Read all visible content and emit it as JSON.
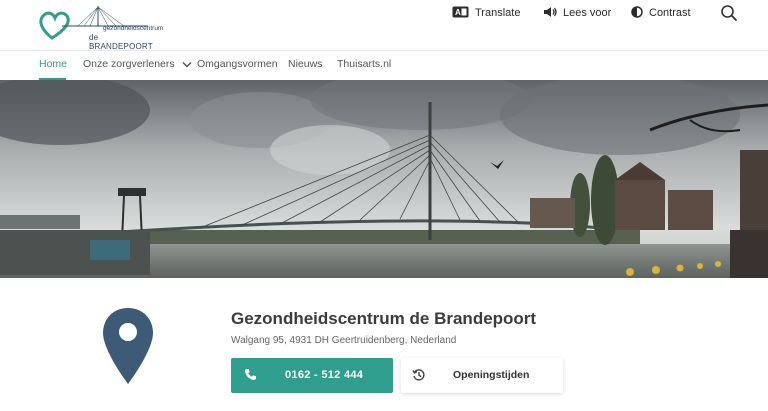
{
  "header": {
    "logo": {
      "line1": "gezondheidscentrum",
      "line2": "de BRANDEPOORT",
      "brand_teal": "#2f9e8f",
      "brand_navy": "#2b4a63"
    },
    "utilities": {
      "translate": {
        "label": "Translate",
        "icon": "translate-icon"
      },
      "lees_voor": {
        "label": "Lees voor",
        "icon": "speaker-icon"
      },
      "contrast": {
        "label": "Contrast",
        "icon": "contrast-icon"
      },
      "search": {
        "icon": "search-icon"
      }
    }
  },
  "nav": {
    "items": [
      {
        "label": "Home",
        "active": true
      },
      {
        "label": "Onze zorgverleners",
        "has_dropdown": true
      },
      {
        "label": "Omgangsvormen"
      },
      {
        "label": "Nieuws"
      },
      {
        "label": "Thuisarts.nl"
      }
    ]
  },
  "hero": {
    "image": "cable-stayed bridge over river landscape"
  },
  "location": {
    "title": "Gezondheidscentrum de Brandepoort",
    "address": "Walgang 95, 4931 DH Geertruidenberg, Nederland",
    "phone_button": {
      "label": "0162 - 512 444",
      "icon": "phone-icon"
    },
    "hours_button": {
      "label": "Openingstijden",
      "icon": "history-icon"
    },
    "pin_icon": "map-pin-icon",
    "pin_color": "#3d5a76"
  }
}
